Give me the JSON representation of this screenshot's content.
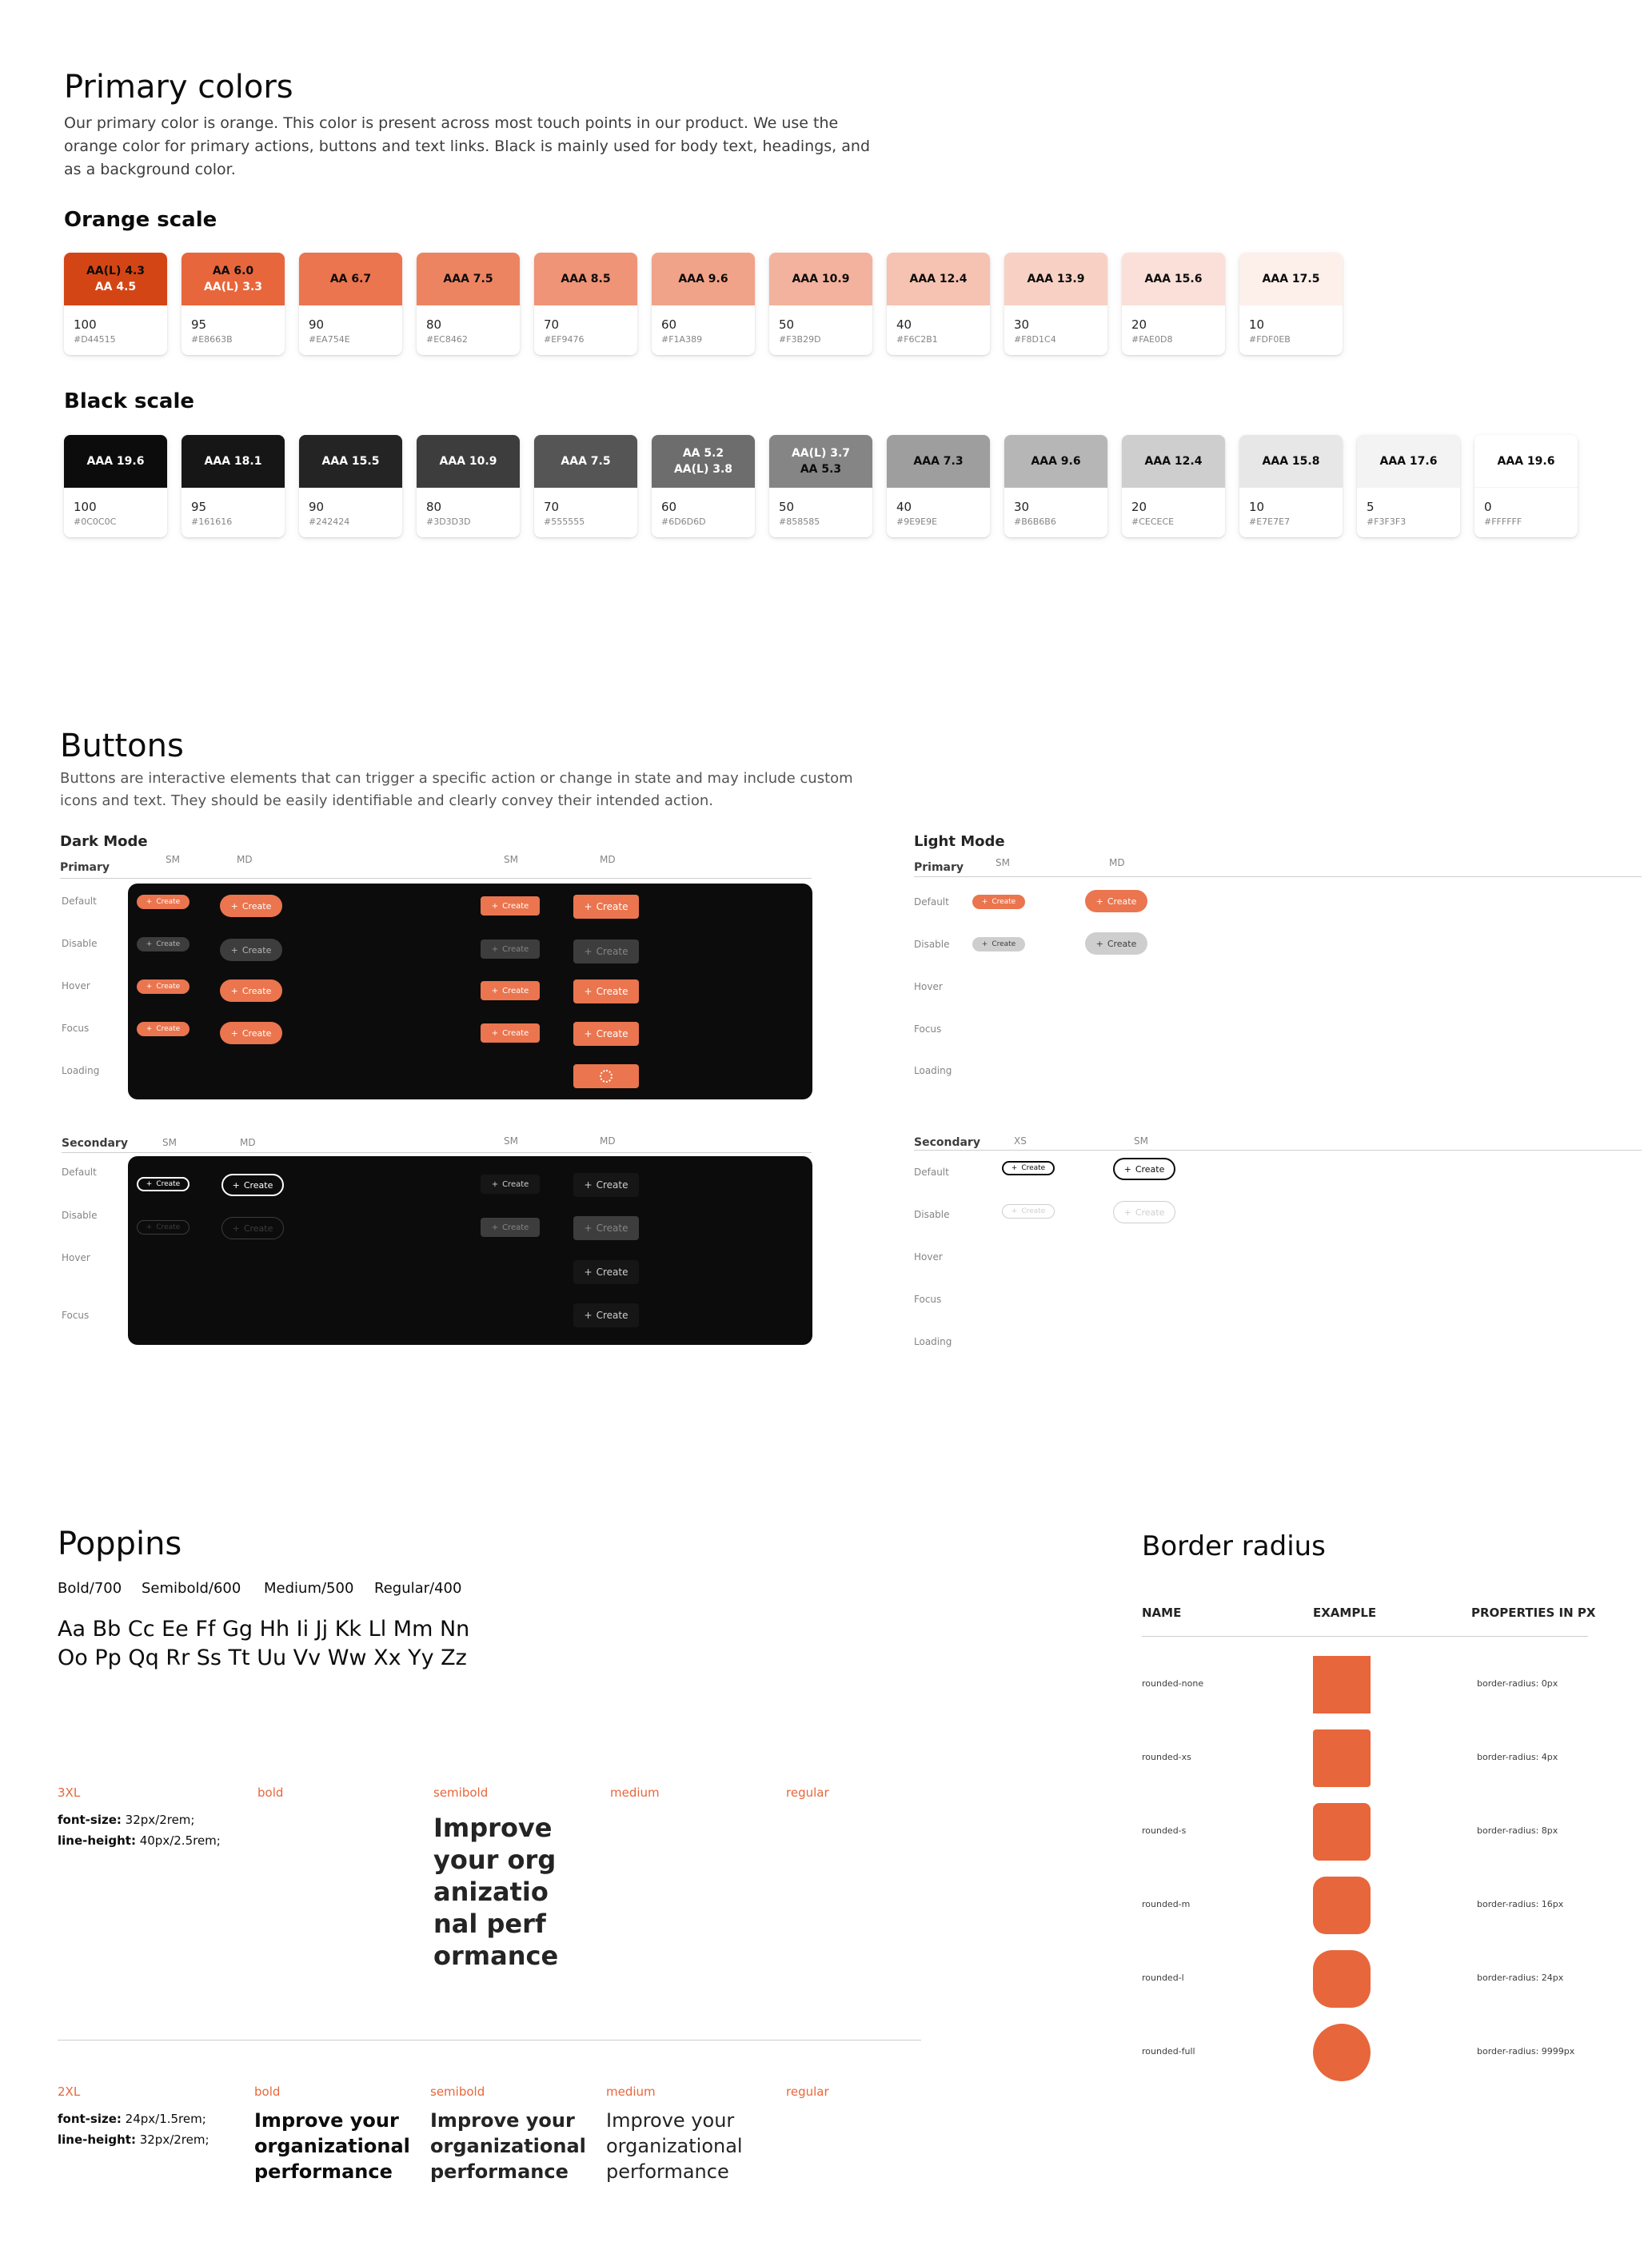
{
  "primary_colors": {
    "title": "Primary colors",
    "description": "Our primary color is orange. This color is present across most touch points in our product. We use the orange color for primary actions, buttons and text links. Black is mainly used for body text, headings, and as a background color.",
    "orange_scale": {
      "title": "Orange scale",
      "swatches": [
        {
          "line1": "AA(L) 4.3",
          "line2": "AA 4.5",
          "value": "100",
          "hex": "#D44515",
          "color": "#D44515",
          "fg1": "#0C0C0C",
          "fg2": "#FFFFFF"
        },
        {
          "line1": "AA 6.0",
          "line2": "AA(L) 3.3",
          "value": "95",
          "hex": "#E8663B",
          "color": "#E8663B",
          "fg1": "#0C0C0C",
          "fg2": "#FFFFFF"
        },
        {
          "line1": "AA 6.7",
          "line2": "",
          "value": "90",
          "hex": "#EA754E",
          "color": "#EA754E",
          "fg1": "#0C0C0C",
          "fg2": "#0C0C0C"
        },
        {
          "line1": "AAA 7.5",
          "line2": "",
          "value": "80",
          "hex": "#EC8462",
          "color": "#EC8462",
          "fg1": "#0C0C0C",
          "fg2": "#0C0C0C"
        },
        {
          "line1": "AAA 8.5",
          "line2": "",
          "value": "70",
          "hex": "#EF9476",
          "color": "#EF9476",
          "fg1": "#0C0C0C",
          "fg2": "#0C0C0C"
        },
        {
          "line1": "AAA 9.6",
          "line2": "",
          "value": "60",
          "hex": "#F1A389",
          "color": "#F1A389",
          "fg1": "#0C0C0C",
          "fg2": "#0C0C0C"
        },
        {
          "line1": "AAA 10.9",
          "line2": "",
          "value": "50",
          "hex": "#F3B29D",
          "color": "#F3B29D",
          "fg1": "#0C0C0C",
          "fg2": "#0C0C0C"
        },
        {
          "line1": "AAA 12.4",
          "line2": "",
          "value": "40",
          "hex": "#F6C2B1",
          "color": "#F6C2B1",
          "fg1": "#0C0C0C",
          "fg2": "#0C0C0C"
        },
        {
          "line1": "AAA 13.9",
          "line2": "",
          "value": "30",
          "hex": "#F8D1C4",
          "color": "#F8D1C4",
          "fg1": "#0C0C0C",
          "fg2": "#0C0C0C"
        },
        {
          "line1": "AAA 15.6",
          "line2": "",
          "value": "20",
          "hex": "#FAE0D8",
          "color": "#FAE0D8",
          "fg1": "#0C0C0C",
          "fg2": "#0C0C0C"
        },
        {
          "line1": "AAA 17.5",
          "line2": "",
          "value": "10",
          "hex": "#FDF0EB",
          "color": "#FDF0EB",
          "fg1": "#0C0C0C",
          "fg2": "#0C0C0C"
        }
      ]
    },
    "black_scale": {
      "title": "Black scale",
      "swatches": [
        {
          "line1": "AAA 19.6",
          "line2": "",
          "value": "100",
          "hex": "#0C0C0C",
          "color": "#0C0C0C",
          "fg1": "#FFFFFF",
          "fg2": "#FFFFFF"
        },
        {
          "line1": "AAA 18.1",
          "line2": "",
          "value": "95",
          "hex": "#161616",
          "color": "#161616",
          "fg1": "#FFFFFF",
          "fg2": "#FFFFFF"
        },
        {
          "line1": "AAA 15.5",
          "line2": "",
          "value": "90",
          "hex": "#242424",
          "color": "#242424",
          "fg1": "#FFFFFF",
          "fg2": "#FFFFFF"
        },
        {
          "line1": "AAA 10.9",
          "line2": "",
          "value": "80",
          "hex": "#3D3D3D",
          "color": "#3D3D3D",
          "fg1": "#FFFFFF",
          "fg2": "#FFFFFF"
        },
        {
          "line1": "AAA 7.5",
          "line2": "",
          "value": "70",
          "hex": "#555555",
          "color": "#555555",
          "fg1": "#FFFFFF",
          "fg2": "#FFFFFF"
        },
        {
          "line1": "AA 5.2",
          "line2": "AA(L) 3.8",
          "value": "60",
          "hex": "#6D6D6D",
          "color": "#6D6D6D",
          "fg1": "#FFFFFF",
          "fg2": "#FFFFFF"
        },
        {
          "line1": "AA(L) 3.7",
          "line2": "AA 5.3",
          "value": "50",
          "hex": "#858585",
          "color": "#858585",
          "fg1": "#FFFFFF",
          "fg2": "#0C0C0C"
        },
        {
          "line1": "AAA 7.3",
          "line2": "",
          "value": "40",
          "hex": "#9E9E9E",
          "color": "#9E9E9E",
          "fg1": "#0C0C0C",
          "fg2": "#0C0C0C"
        },
        {
          "line1": "AAA 9.6",
          "line2": "",
          "value": "30",
          "hex": "#B6B6B6",
          "color": "#B6B6B6",
          "fg1": "#0C0C0C",
          "fg2": "#0C0C0C"
        },
        {
          "line1": "AAA 12.4",
          "line2": "",
          "value": "20",
          "hex": "#CECECE",
          "color": "#CECECE",
          "fg1": "#0C0C0C",
          "fg2": "#0C0C0C"
        },
        {
          "line1": "AAA 15.8",
          "line2": "",
          "value": "10",
          "hex": "#E7E7E7",
          "color": "#E7E7E7",
          "fg1": "#0C0C0C",
          "fg2": "#0C0C0C"
        },
        {
          "line1": "AAA 17.6",
          "line2": "",
          "value": "5",
          "hex": "#F3F3F3",
          "color": "#F3F3F3",
          "fg1": "#0C0C0C",
          "fg2": "#0C0C0C"
        },
        {
          "line1": "AAA 19.6",
          "line2": "",
          "value": "0",
          "hex": "#FFFFFF",
          "color": "#FFFFFF",
          "fg1": "#0C0C0C",
          "fg2": "#0C0C0C"
        }
      ]
    }
  },
  "buttons": {
    "title": "Buttons",
    "description": "Buttons are interactive elements that can trigger a specific action or change in state and may include custom icons and text. They should be easily identifiable and clearly convey their intended action.",
    "button_label": "Create",
    "plus_icon": "plus-icon",
    "dark_mode": {
      "title": "Dark Mode",
      "primary": {
        "label": "Primary",
        "cols": [
          "SM",
          "MD",
          "SM",
          "MD"
        ],
        "rows": [
          "Default",
          "Disable",
          "Hover",
          "Focus",
          "Loading"
        ]
      },
      "secondary": {
        "label": "Secondary",
        "cols": [
          "SM",
          "MD",
          "SM",
          "MD"
        ],
        "rows": [
          "Default",
          "Disable",
          "Hover",
          "Focus"
        ]
      }
    },
    "light_mode": {
      "title": "Light Mode",
      "primary": {
        "label": "Primary",
        "cols": [
          "SM",
          "MD"
        ],
        "rows": [
          "Default",
          "Disable",
          "Hover",
          "Focus",
          "Loading"
        ]
      },
      "secondary": {
        "label": "Secondary",
        "cols": [
          "XS",
          "SM"
        ],
        "rows": [
          "Default",
          "Disable",
          "Hover",
          "Focus",
          "Loading"
        ]
      }
    }
  },
  "typography": {
    "title": "Poppins",
    "weights": [
      "Bold/700",
      "Semibold/600",
      "Medium/500",
      "Regular/400"
    ],
    "alphabet": "Aa Bb Cc Ee Ff Gg Hh Ii Jj Kk Ll Mm Nn Oo Pp Qq Rr Ss Tt Uu Vv Ww Xx Yy Zz",
    "sizes": [
      {
        "name": "3XL",
        "cols": [
          "bold",
          "semibold",
          "medium",
          "regular"
        ],
        "font_size_label": "font-size:",
        "font_size": " 32px/2rem;",
        "line_height_label": "line-height:",
        "line_height": " 40px/2.5rem;",
        "sample": "Improve your organizational performance"
      },
      {
        "name": "2XL",
        "cols": [
          "bold",
          "semibold",
          "medium",
          "regular"
        ],
        "font_size_label": "font-size:",
        "font_size": " 24px/1.5rem;",
        "line_height_label": "line-height:",
        "line_height": " 32px/2rem;",
        "sample": "Improve your organizational performance"
      }
    ]
  },
  "border_radius": {
    "title": "Border radius",
    "headers": [
      "NAME",
      "EXAMPLE",
      "PROPERTIES IN PX"
    ],
    "rows": [
      {
        "name": "rounded-none",
        "property": "border-radius: 0px",
        "radius": 0
      },
      {
        "name": "rounded-xs",
        "property": "border-radius: 4px",
        "radius": 4
      },
      {
        "name": "rounded-s",
        "property": "border-radius: 8px",
        "radius": 8
      },
      {
        "name": "rounded-m",
        "property": "border-radius: 16px",
        "radius": 16
      },
      {
        "name": "rounded-l",
        "property": "border-radius: 24px",
        "radius": 24
      },
      {
        "name": "rounded-full",
        "property": "border-radius: 9999px",
        "radius": 9999
      }
    ]
  }
}
